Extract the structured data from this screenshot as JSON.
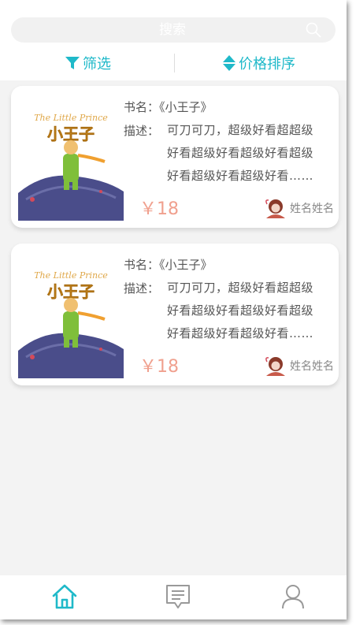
{
  "search": {
    "placeholder": "搜索"
  },
  "filter_bar": {
    "filter_label": "筛选",
    "sort_label": "价格排序"
  },
  "colors": {
    "accent": "#1fb9c9",
    "price": "#f0a08e",
    "background": "#f3f3f3"
  },
  "books": [
    {
      "title_label": "书名：",
      "title": "《小王子》",
      "desc_label": "描述：",
      "desc_lines": [
        "可刀可刀，超级好看超超级",
        "好看超级好看超级好看超级",
        "好看超级好看超级好看……"
      ],
      "price": "￥18",
      "author": "姓名姓名",
      "cover_title": "The Little Prince",
      "cover_cn": "小王子"
    },
    {
      "title_label": "书名：",
      "title": "《小王子》",
      "desc_label": "描述：",
      "desc_lines": [
        "可刀可刀，超级好看超超级",
        "好看超级好看超级好看超级",
        "好看超级好看超级好看……"
      ],
      "price": "￥18",
      "author": "姓名姓名",
      "cover_title": "The Little Prince",
      "cover_cn": "小王子"
    }
  ],
  "bottom_nav": {
    "items": [
      {
        "icon": "home-icon",
        "active": true
      },
      {
        "icon": "message-icon",
        "active": false
      },
      {
        "icon": "user-icon",
        "active": false
      }
    ]
  }
}
